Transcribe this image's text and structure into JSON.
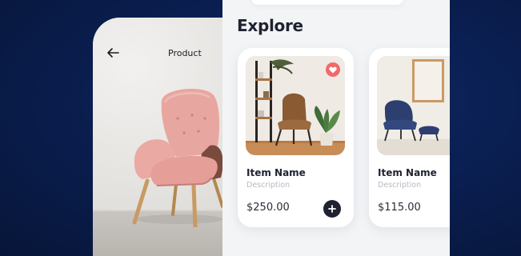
{
  "product_screen": {
    "title": "Product",
    "back_icon": "arrow-left-icon"
  },
  "explore": {
    "title": "Explore",
    "cards": [
      {
        "name": "Item Name",
        "description": "Description",
        "price": "$250.00",
        "favorite": true
      },
      {
        "name": "Item Name",
        "description": "Description",
        "price": "$115.00",
        "favorite": false
      }
    ]
  },
  "colors": {
    "background": "#0a1f52",
    "panel": "#f3f4f6",
    "text_dark": "#1f2230",
    "favorite": "#f06a6a",
    "muted_text": "#b6b9c2"
  }
}
